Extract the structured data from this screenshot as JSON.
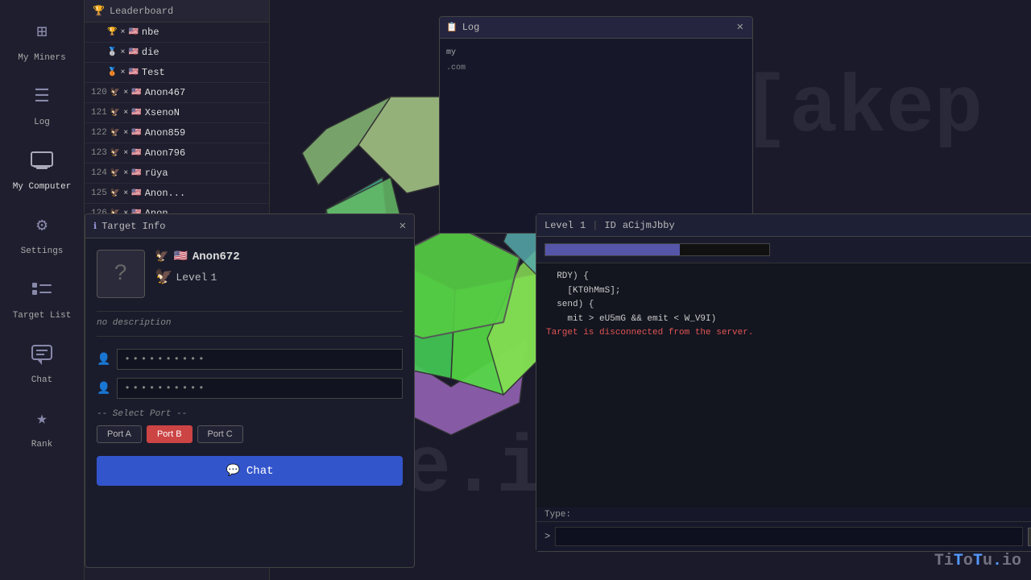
{
  "sidebar": {
    "items": [
      {
        "id": "my-miners",
        "icon": "⊞",
        "label": "My Miners"
      },
      {
        "id": "log",
        "icon": "≡",
        "label": "Log"
      },
      {
        "id": "my-computer",
        "icon": "🖥",
        "label": "My Computer"
      },
      {
        "id": "settings",
        "icon": "⚙",
        "label": "Settings"
      },
      {
        "id": "target-list",
        "icon": "📊",
        "label": "Target List"
      },
      {
        "id": "chat",
        "icon": "💬",
        "label": "Chat"
      },
      {
        "id": "rank",
        "icon": "★",
        "label": "Rank"
      }
    ]
  },
  "leaderboard": {
    "header": "Leaderboard",
    "entries": [
      {
        "rank": "",
        "trophy": "🏆",
        "flag": "🇺🇸",
        "name": "nbe"
      },
      {
        "rank": "",
        "trophy": "🥈",
        "flag": "🇺🇸",
        "name": "die"
      },
      {
        "rank": "",
        "trophy": "🥉",
        "flag": "🇺🇸",
        "name": "Test"
      },
      {
        "rank": "120",
        "trophy": "🦅",
        "flag": "🇺🇸",
        "name": "Anon467"
      },
      {
        "rank": "121",
        "trophy": "🦅",
        "flag": "🇺🇸",
        "name": "XsenoN"
      },
      {
        "rank": "122",
        "trophy": "🦅",
        "flag": "🇺🇸",
        "name": "Anon859"
      },
      {
        "rank": "123",
        "trophy": "🦅",
        "flag": "🇺🇸",
        "name": "Anon796"
      },
      {
        "rank": "124",
        "trophy": "🦅",
        "flag": "🇺🇸",
        "name": "rüya"
      },
      {
        "rank": "125",
        "trophy": "🦅",
        "flag": "🇺🇸",
        "name": "Anon..."
      },
      {
        "rank": "126",
        "trophy": "🦅",
        "flag": "🇺🇸",
        "name": "Anon..."
      }
    ]
  },
  "log_window": {
    "title": "Log",
    "icon": "📋",
    "close": "✕"
  },
  "terminal_window": {
    "close": "✕",
    "level_label": "Level",
    "level_value": "1",
    "id_label": "ID",
    "id_value": "aCijmJbby",
    "separator": "|",
    "code_lines": [
      "RDY) {",
      "[KT0hMmS];",
      "",
      "send) {",
      "mit > eU5mG && emit < W_V9I)",
      "",
      "Target is disconnected from the server."
    ],
    "type_label": "Type:",
    "prompt": ">",
    "input_placeholder": ""
  },
  "target_info": {
    "title": "Target Info",
    "icon": "ℹ",
    "close": "✕",
    "name": "Anon672",
    "level_label": "Level",
    "level_value": "1",
    "description": "no description",
    "input1_placeholder": "••••••••••",
    "input2_placeholder": "••••••••••",
    "select_port_hint": "-- Select Port --",
    "ports": [
      "Port A",
      "Port B",
      "Port C"
    ],
    "active_port": "Port B",
    "chat_button_label": "Chat",
    "chat_icon": "💬"
  },
  "watermarks": {
    "akep": "][akep",
    "source": "s0urce.io",
    "titotu_diagonal": "titotu.io"
  },
  "titotu_logo": "TiToTu.io"
}
